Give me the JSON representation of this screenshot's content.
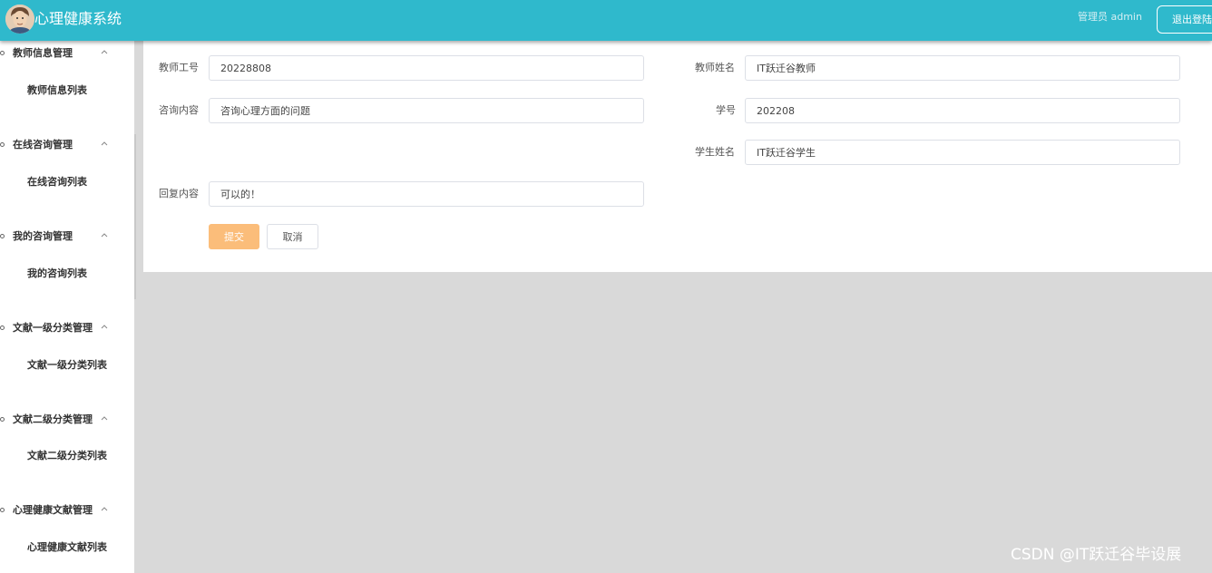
{
  "header": {
    "title": "心理健康系统",
    "admin_label": "管理员 admin",
    "logout_label": "退出登陆",
    "bg_color": "#2fb9cc"
  },
  "sidebar": {
    "groups": [
      {
        "label": "教师信息管理",
        "items": [
          "教师信息列表"
        ]
      },
      {
        "label": "在线咨询管理",
        "items": [
          "在线咨询列表"
        ]
      },
      {
        "label": "我的咨询管理",
        "items": [
          "我的咨询列表"
        ]
      },
      {
        "label": "文献一级分类管理",
        "items": [
          "文献一级分类列表"
        ]
      },
      {
        "label": "文献二级分类管理",
        "items": [
          "文献二级分类列表"
        ]
      },
      {
        "label": "心理健康文献管理",
        "items": [
          "心理健康文献列表"
        ]
      }
    ]
  },
  "form": {
    "fields": {
      "teacher_id": {
        "label": "教师工号",
        "value": "20228808"
      },
      "teacher_name": {
        "label": "教师姓名",
        "value": "IT跃迁谷教师"
      },
      "consult_content": {
        "label": "咨询内容",
        "value": "咨询心理方面的问题"
      },
      "student_id": {
        "label": "学号",
        "value": "202208"
      },
      "student_name": {
        "label": "学生姓名",
        "value": "IT跃迁谷学生"
      },
      "reply_content": {
        "label": "回复内容",
        "value": "可以的！"
      }
    },
    "submit_label": "提交",
    "cancel_label": "取消",
    "submit_color": "#fbbd7a"
  },
  "watermark": "CSDN @IT跃迁谷毕设展"
}
